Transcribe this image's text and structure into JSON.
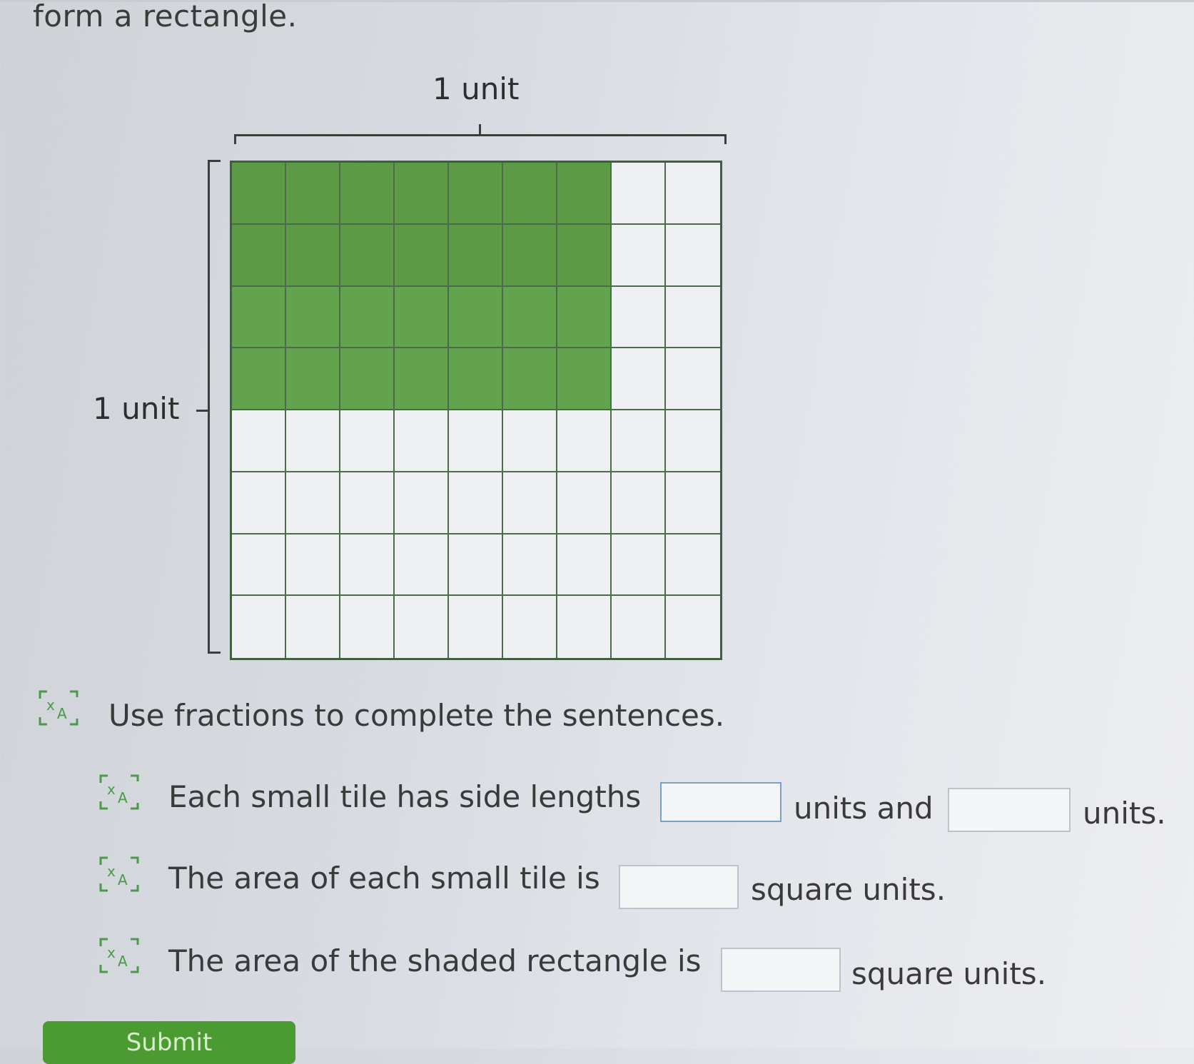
{
  "header": {
    "text": "form a rectangle."
  },
  "diagram": {
    "top_label": "1 unit",
    "side_label": "1 unit",
    "grid": {
      "columns": 9,
      "rows": 8,
      "shaded_columns": 7,
      "shaded_rows": 4
    }
  },
  "instructions": {
    "text": "Use fractions to complete the sentences."
  },
  "sentences": [
    {
      "part1": "Each small tile has side lengths",
      "part2": "units and",
      "part3": "units."
    },
    {
      "part1": "The area of each small tile is",
      "part2": "square units."
    },
    {
      "part1": "The area of the shaded rectangle is",
      "part2": "square units."
    }
  ],
  "icons": {
    "text_to_speech": "text-to-speech-icon"
  },
  "colors": {
    "shaded": "#5c9a46",
    "submit": "#4c9a32",
    "icon": "#4a9a4a"
  },
  "submit": {
    "label": "Submit"
  }
}
